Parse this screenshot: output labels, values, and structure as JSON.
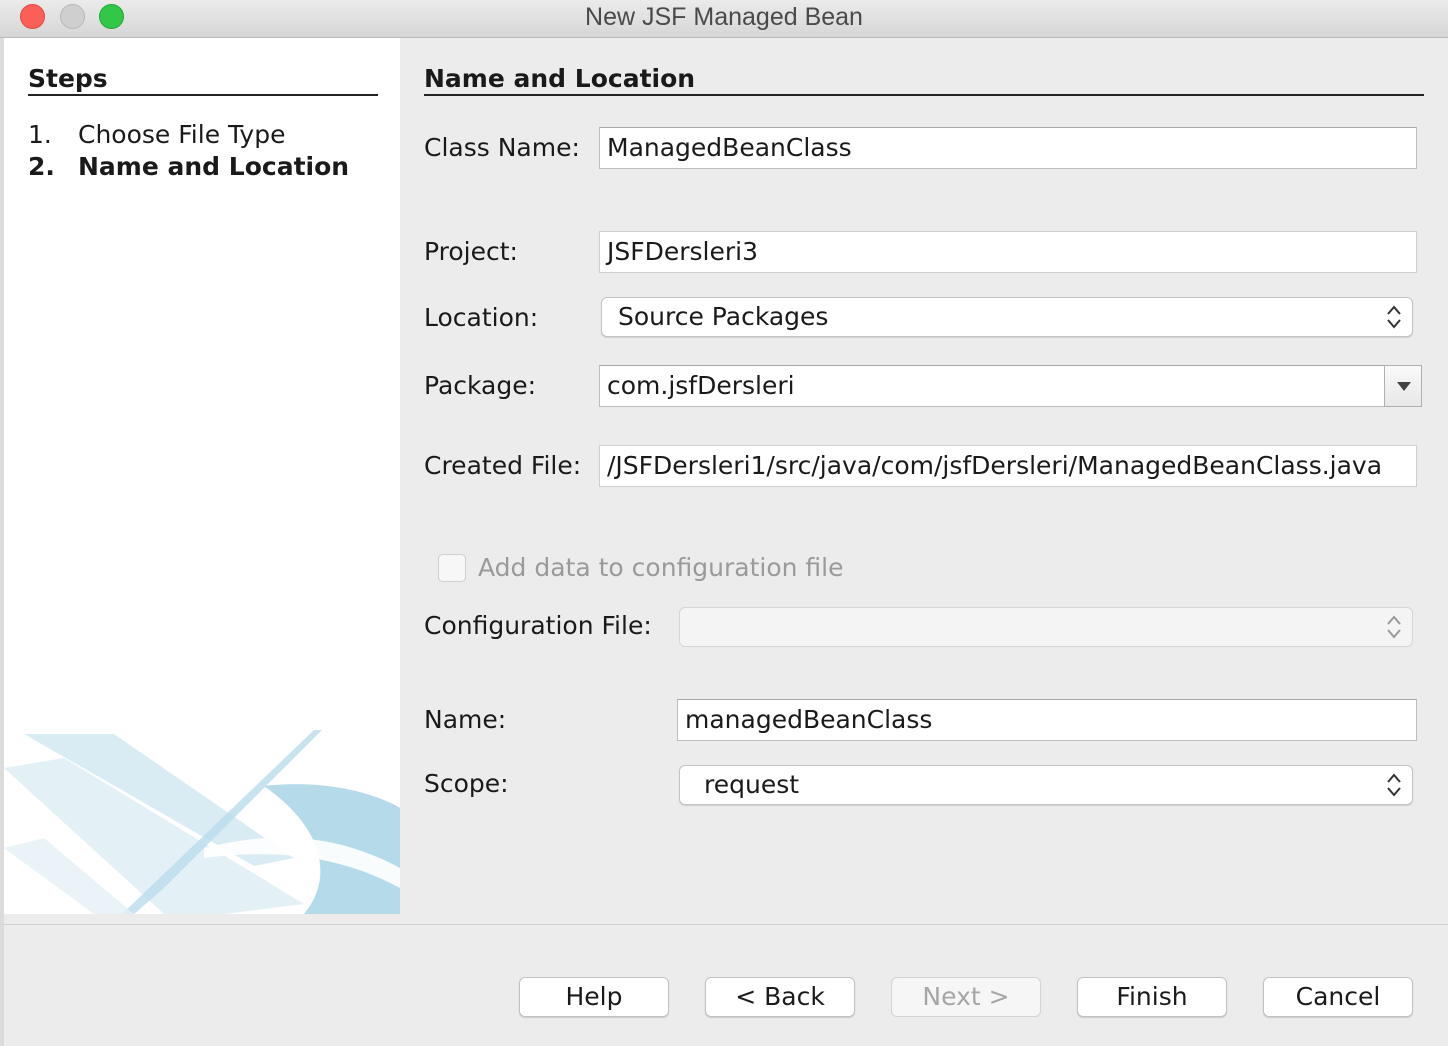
{
  "window": {
    "title": "New JSF Managed Bean"
  },
  "steps": {
    "title": "Steps",
    "items": [
      {
        "number": "1.",
        "label": "Choose File Type",
        "current": false
      },
      {
        "number": "2.",
        "label": "Name and Location",
        "current": true
      }
    ]
  },
  "form": {
    "section_title": "Name and Location",
    "class_name": {
      "label": "Class Name:",
      "value": "ManagedBeanClass"
    },
    "project": {
      "label": "Project:",
      "value": "JSFDersleri3"
    },
    "location": {
      "label": "Location:",
      "value": "Source Packages"
    },
    "package": {
      "label": "Package:",
      "value": "com.jsfDersleri"
    },
    "created_file": {
      "label": "Created File:",
      "value": "/JSFDersleri1/src/java/com/jsfDersleri/ManagedBeanClass.java"
    },
    "add_config": {
      "label": "Add data to configuration file",
      "checked": false,
      "enabled": false
    },
    "config_file": {
      "label": "Configuration File:",
      "value": ""
    },
    "name": {
      "label": "Name:",
      "value": "managedBeanClass"
    },
    "scope": {
      "label": "Scope:",
      "value": "request"
    }
  },
  "buttons": {
    "help": "Help",
    "back": "< Back",
    "next": "Next >",
    "finish": "Finish",
    "cancel": "Cancel"
  },
  "colors": {
    "close": "#fc5f57",
    "minimize": "#cfcfcf",
    "zoom": "#33c748",
    "swoosh": "#a8d4e6"
  }
}
